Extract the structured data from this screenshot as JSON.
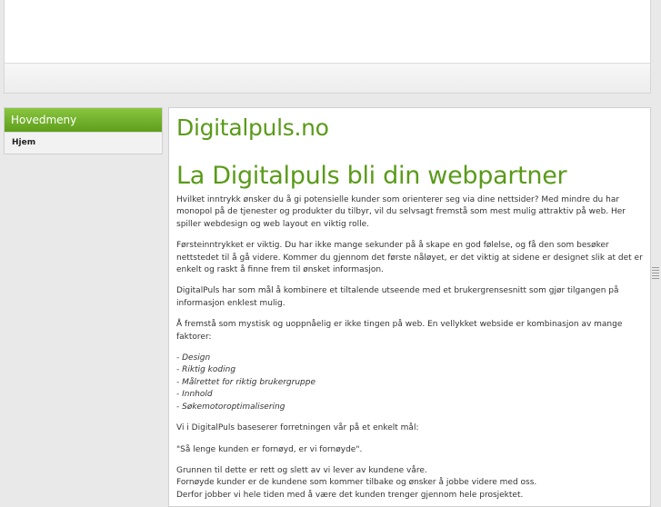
{
  "sidebar": {
    "heading": "Hovedmeny",
    "items": [
      {
        "label": "Hjem"
      }
    ]
  },
  "main": {
    "site_title": "Digitalpuls.no",
    "headline": "La Digitalpuls bli din webpartner",
    "paragraphs": [
      "Hvilket inntrykk ønsker du å gi potensielle kunder som orienterer seg via dine nettsider? Med mindre du har monopol på de tjenester og produkter du tilbyr, vil du selvsagt fremstå som mest mulig attraktiv på web. Her spiller webdesign og web layout en viktig rolle.",
      "Førsteinntrykket er viktig. Du har ikke mange sekunder på å skape en god følelse, og få den som besøker nettstedet til å gå videre. Kommer du gjennom det første nåløyet, er det viktig at sidene er designet slik at det er enkelt og raskt å finne frem til ønsket informasjon.",
      "DigitalPuls har som mål å kombinere et tiltalende utseende med et brukergrensesnitt som gjør tilgangen på informasjon enklest mulig.",
      "Å fremstå som mystisk og uoppnåelig er ikke tingen på web. En vellykket webside er kombinasjon av mange faktorer:"
    ],
    "factors": [
      "- Design",
      "- Riktig koding",
      "- Målrettet for riktig brukergruppe",
      "- Innhold",
      "- Søkemotoroptimalisering"
    ],
    "closing": [
      "Vi i DigitalPuls baseserer forretningen vår på et enkelt mål:",
      "\"Så lenge kunden er fornøyd, er vi fornøyde\"."
    ],
    "final_lines": [
      "Grunnen til dette er rett og slett av vi lever av kundene våre.",
      "Fornøyde kunder er de kundene som kommer tilbake og ønsker å jobbe videre med oss.",
      "Derfor jobber vi hele tiden med å være det kunden trenger gjennom hele prosjektet."
    ]
  },
  "colors": {
    "accent_green": "#5a9a19",
    "menu_header_top": "#88c63f",
    "menu_header_bottom": "#5f9e1c"
  }
}
